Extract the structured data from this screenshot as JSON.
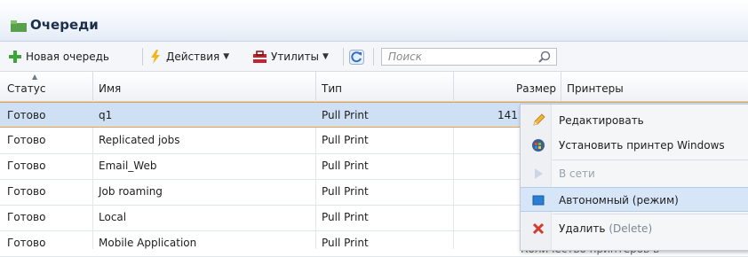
{
  "panel": {
    "title": "Очереди"
  },
  "toolbar": {
    "new_queue": "Новая очередь",
    "actions": "Действия",
    "utilities": "Утилиты",
    "search_placeholder": "Поиск"
  },
  "columns": {
    "status": "Статус",
    "name": "Имя",
    "type": "Тип",
    "size": "Размер",
    "printers": "Принтеры"
  },
  "rows": [
    {
      "status": "Готово",
      "name": "q1",
      "type": "Pull Print",
      "size": "141"
    },
    {
      "status": "Готово",
      "name": "Replicated jobs",
      "type": "Pull Print",
      "size": ""
    },
    {
      "status": "Готово",
      "name": "Email_Web",
      "type": "Pull Print",
      "size": ""
    },
    {
      "status": "Готово",
      "name": "Job roaming",
      "type": "Pull Print",
      "size": ""
    },
    {
      "status": "Готово",
      "name": "Local",
      "type": "Pull Print",
      "size": ""
    },
    {
      "status": "Готово",
      "name": "Mobile Application",
      "type": "Pull Print",
      "size": ""
    }
  ],
  "context_menu": {
    "edit": "Редактировать",
    "set_windows_printer": "Установить принтер Windows",
    "online": "В сети",
    "offline": "Автономный (режим)",
    "delete": "Удалить",
    "delete_hint": "(Delete)"
  },
  "background_partial_text": "Количество принтеров в",
  "icons": {
    "panel": "queue-icon",
    "new_queue": "plus-icon",
    "actions": "lightning-icon",
    "utilities": "toolbox-icon",
    "refresh": "refresh-icon",
    "search": "search-icon",
    "sort": "sort-asc-icon",
    "edit": "pencil-icon",
    "set_windows_printer": "windows-globe-icon",
    "online": "play-icon",
    "offline": "offline-square-icon",
    "delete": "delete-x-icon"
  },
  "colors": {
    "selected_row": "#cfe0f5",
    "selected_border": "#f0a23a",
    "menu_hover": "#d6e6f8",
    "plus": "#3aa53a",
    "delete": "#d33b2c"
  }
}
